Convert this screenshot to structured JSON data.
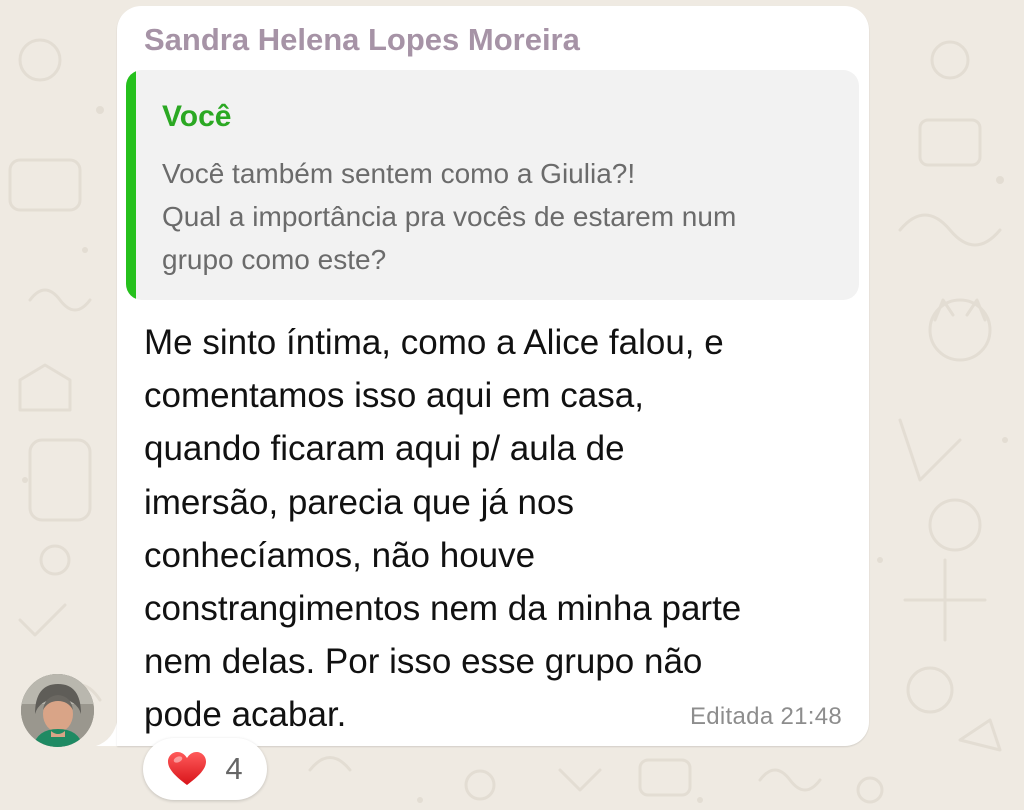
{
  "message": {
    "sender_name": "Sandra Helena Lopes Moreira",
    "quoted": {
      "author": "Você",
      "lines": [
        "Você também sentem como a Giulia?!",
        "Qual a importância pra vocês de estarem num",
        "grupo como este?"
      ]
    },
    "body_lines": [
      "Me sinto íntima, como a Alice  falou, e",
      "comentamos isso aqui em casa,",
      "quando ficaram aqui p/ aula de",
      "imersão, parecia que já nos",
      "conhecíamos, não houve",
      "constrangimentos nem da minha parte",
      "nem delas. Por isso esse grupo não",
      "pode acabar."
    ],
    "edited_label": "Editada",
    "time": "21:48"
  },
  "reaction": {
    "emoji_icon": "red-heart-icon",
    "count": "4"
  },
  "colors": {
    "chat_background": "#efeae2",
    "bubble": "#ffffff",
    "sender_name": "#a693a6",
    "quote_accent": "#25c01c",
    "quote_author": "#2ba823"
  }
}
